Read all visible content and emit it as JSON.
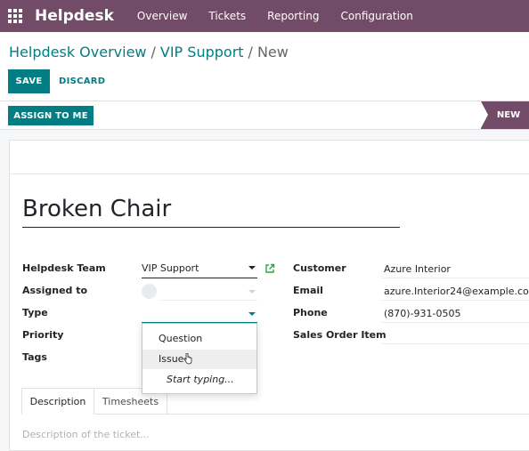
{
  "navbar": {
    "brand": "Helpdesk",
    "menu": [
      "Overview",
      "Tickets",
      "Reporting",
      "Configuration"
    ]
  },
  "breadcrumb": {
    "items": [
      "Helpdesk Overview",
      "VIP Support"
    ],
    "current": "New",
    "separator": "/"
  },
  "actions": {
    "save": "SAVE",
    "discard": "DISCARD"
  },
  "statusbar": {
    "assign": "ASSIGN TO ME",
    "stage": "NEW"
  },
  "ticket": {
    "title": "Broken Chair"
  },
  "left_fields": {
    "team_label": "Helpdesk Team",
    "team_value": "VIP Support",
    "assigned_label": "Assigned to",
    "type_label": "Type",
    "priority_label": "Priority",
    "tags_label": "Tags"
  },
  "right_fields": {
    "customer_label": "Customer",
    "customer_value": "Azure Interior",
    "email_label": "Email",
    "email_value": "azure.Interior24@example.com",
    "phone_label": "Phone",
    "phone_value": "(870)-931-0505",
    "sales_order_label": "Sales Order Item"
  },
  "type_dropdown": {
    "options": [
      "Question",
      "Issue"
    ],
    "create_hint": "Start typing..."
  },
  "tabs": [
    "Description",
    "Timesheets"
  ],
  "description": {
    "placeholder": "Description of the ticket..."
  },
  "colors": {
    "brand": "#714B67",
    "accent": "#017e84"
  },
  "icons": {
    "apps": "apps-grid-icon",
    "external_link": "external-link-icon",
    "cursor": "hand-cursor-icon"
  }
}
